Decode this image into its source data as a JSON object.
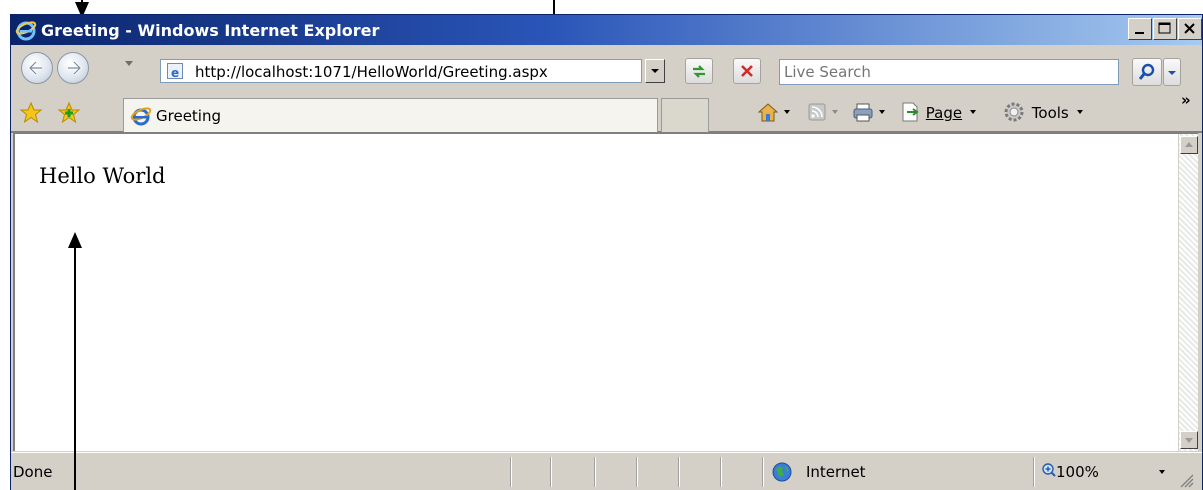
{
  "window": {
    "title": "Greeting - Windows Internet Explorer"
  },
  "navigation": {
    "address": "http://localhost:1071/HelloWorld/Greeting.aspx",
    "search_placeholder": "Live Search"
  },
  "tabs": [
    {
      "label": "Greeting"
    }
  ],
  "commandbar": {
    "page_label": "Page",
    "tools_label": "Tools",
    "overflow": "»"
  },
  "content": {
    "text": "Hello World"
  },
  "statusbar": {
    "status": "Done",
    "zone": "Internet",
    "zoom": "100%"
  },
  "colors": {
    "titlebar": "#0a246a",
    "chrome": "#d4d0c8"
  }
}
